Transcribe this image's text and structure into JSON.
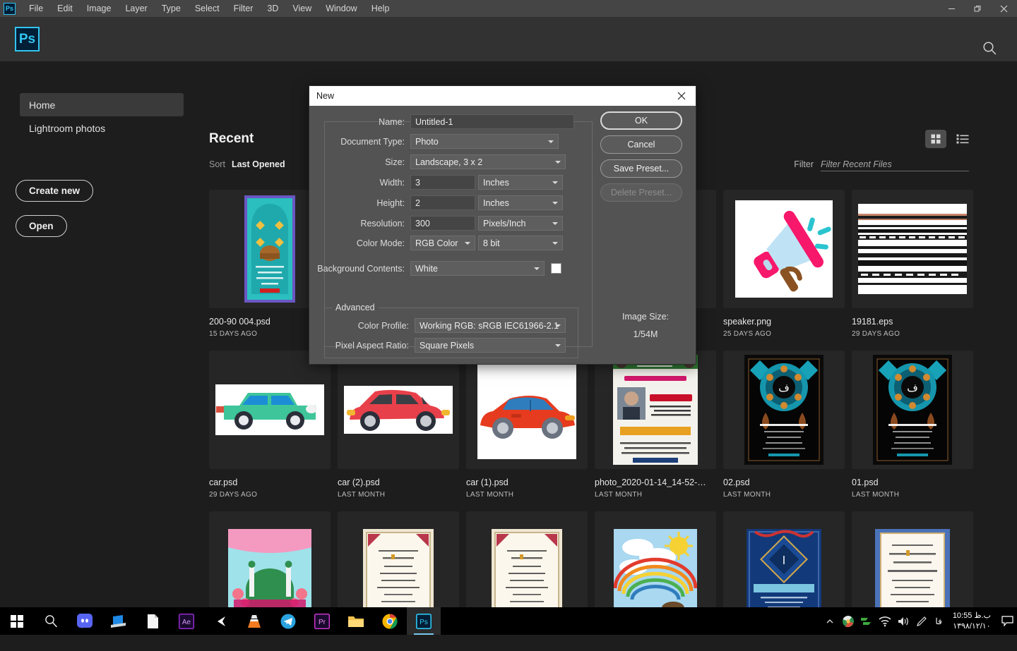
{
  "app": {
    "title": "Adobe Photoshop",
    "logo_text": "Ps",
    "accent": "#31c5f0"
  },
  "menubar": {
    "items": [
      {
        "label": "File"
      },
      {
        "label": "Edit"
      },
      {
        "label": "Image"
      },
      {
        "label": "Layer"
      },
      {
        "label": "Type"
      },
      {
        "label": "Select"
      },
      {
        "label": "Filter"
      },
      {
        "label": "3D"
      },
      {
        "label": "View"
      },
      {
        "label": "Window"
      },
      {
        "label": "Help"
      }
    ],
    "window_controls": {
      "minimize": "—",
      "restore": "❐",
      "close": "✕"
    }
  },
  "header": {
    "search_icon": "search-icon"
  },
  "sidebar": {
    "items": [
      {
        "label": "Home",
        "active": true
      },
      {
        "label": "Lightroom photos",
        "active": false
      }
    ],
    "buttons": [
      {
        "label": "Create new"
      },
      {
        "label": "Open"
      }
    ]
  },
  "recent": {
    "title": "Recent",
    "sort_label": "Sort",
    "sort_value": "Last Opened",
    "filter_label": "Filter",
    "filter_placeholder": "Filter Recent Files",
    "filter_value": "",
    "view_grid_icon": "grid-view-icon",
    "view_list_icon": "list-view-icon",
    "view_mode": "grid",
    "files": [
      {
        "name": "200-90 004.psd",
        "date": "15 DAYS AGO",
        "thumb": "poster-teal-arch"
      },
      {
        "name": "",
        "date": "",
        "thumb": "hidden-behind-dialog"
      },
      {
        "name": "",
        "date": "",
        "thumb": "hidden-behind-dialog"
      },
      {
        "name": "",
        "date": "",
        "thumb": "hidden-behind-dialog"
      },
      {
        "name": "speaker.png",
        "date": "25 DAYS AGO",
        "thumb": "megaphone"
      },
      {
        "name": "19181.eps",
        "date": "29 DAYS AGO",
        "thumb": "stripes"
      },
      {
        "name": "car.psd",
        "date": "29 DAYS AGO",
        "thumb": "car-green"
      },
      {
        "name": "car (2).psd",
        "date": "LAST MONTH",
        "thumb": "car-red-hatch"
      },
      {
        "name": "car (1).psd",
        "date": "LAST MONTH",
        "thumb": "car-red-blue"
      },
      {
        "name": "photo_2020-01-14_14-52-26....",
        "date": "LAST MONTH",
        "thumb": "poster-event"
      },
      {
        "name": "02.psd",
        "date": "LAST MONTH",
        "thumb": "poster-dark-medallion"
      },
      {
        "name": "01.psd",
        "date": "LAST MONTH",
        "thumb": "poster-dark-medallion"
      },
      {
        "name": "",
        "date": "",
        "thumb": "poster-green-dome"
      },
      {
        "name": "",
        "date": "",
        "thumb": "certificate-cream"
      },
      {
        "name": "",
        "date": "",
        "thumb": "certificate-cream"
      },
      {
        "name": "",
        "date": "",
        "thumb": "poster-rainbow-sky"
      },
      {
        "name": "",
        "date": "",
        "thumb": "poster-blue-ornament"
      },
      {
        "name": "",
        "date": "",
        "thumb": "certificate-blue"
      }
    ]
  },
  "dialog": {
    "title": "New",
    "close_icon": "close-icon",
    "fields": {
      "name_label": "Name:",
      "name_value": "Untitled-1",
      "doctype_label": "Document Type:",
      "doctype_value": "Photo",
      "size_label": "Size:",
      "size_value": "Landscape, 3 x 2",
      "width_label": "Width:",
      "width_value": "3",
      "width_unit": "Inches",
      "height_label": "Height:",
      "height_value": "2",
      "height_unit": "Inches",
      "resolution_label": "Resolution:",
      "resolution_value": "300",
      "resolution_unit": "Pixels/Inch",
      "colormode_label": "Color Mode:",
      "colormode_value": "RGB Color",
      "colordepth_value": "8 bit",
      "background_label": "Background Contents:",
      "background_value": "White",
      "background_swatch": "#ffffff"
    },
    "advanced": {
      "legend": "Advanced",
      "color_profile_label": "Color Profile:",
      "color_profile_value": "Working RGB:  sRGB IEC61966-2.1",
      "pixel_aspect_label": "Pixel Aspect Ratio:",
      "pixel_aspect_value": "Square Pixels"
    },
    "buttons": {
      "ok": "OK",
      "cancel": "Cancel",
      "save_preset": "Save Preset...",
      "delete_preset": "Delete Preset..."
    },
    "image_size_label": "Image Size:",
    "image_size_value": "1/54M"
  },
  "taskbar": {
    "icons": [
      {
        "name": "windows-start-icon"
      },
      {
        "name": "search-icon"
      },
      {
        "name": "discord-icon"
      },
      {
        "name": "device-icon"
      },
      {
        "name": "document-icon"
      },
      {
        "name": "after-effects-icon",
        "label": "Ae"
      },
      {
        "name": "unity-icon"
      },
      {
        "name": "vlc-icon"
      },
      {
        "name": "telegram-icon"
      },
      {
        "name": "premiere-icon",
        "label": "Pr"
      },
      {
        "name": "file-explorer-icon"
      },
      {
        "name": "chrome-icon"
      },
      {
        "name": "photoshop-icon",
        "label": "Ps",
        "active": true
      }
    ],
    "tray": {
      "chevron": "⌃",
      "language": "فا",
      "time": "10:55 ب.ظ",
      "date": "۱۳۹۸/۱۲/۱۰"
    }
  }
}
